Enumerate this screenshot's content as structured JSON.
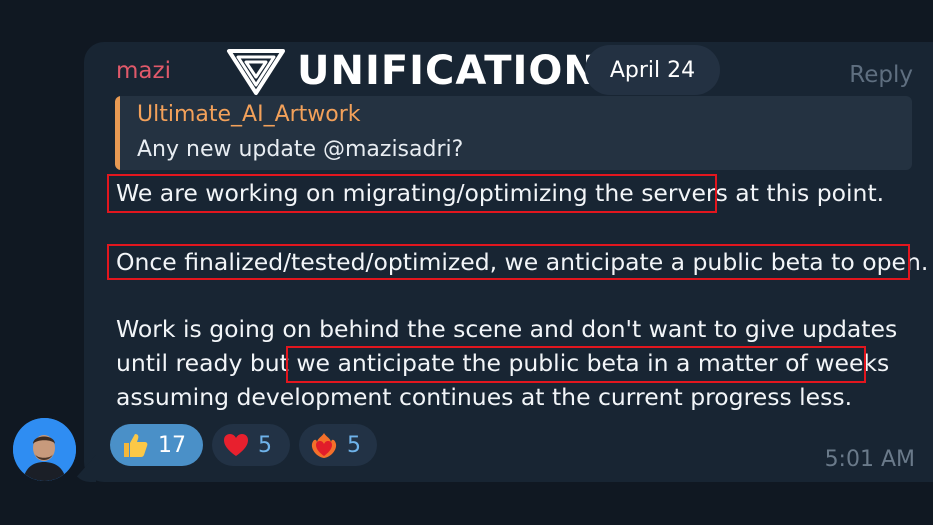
{
  "message": {
    "sender": "mazi",
    "reply_label": "Reply",
    "date": "April 24",
    "time": "5:01 AM",
    "quote": {
      "author": "Ultimate_AI_Artwork",
      "text": "Any new update @mazisadri?"
    },
    "lines": [
      "We are working on migrating/optimizing the servers at this point.",
      "Once finalized/tested/optimized, we anticipate a public beta to open.",
      "Work is going on behind the scene and don't want to give updates",
      "until ready but we anticipate the public beta in a matter of weeks",
      "assuming development continues at the current progress less."
    ]
  },
  "watermark": {
    "text": "UNIFICATION"
  },
  "reactions": [
    {
      "emoji": "thumbs-up",
      "count": "17"
    },
    {
      "emoji": "red-heart",
      "count": "5"
    },
    {
      "emoji": "heart-on-fire",
      "count": "5"
    }
  ],
  "colors": {
    "background": "#101822",
    "bubble": "#182533",
    "sender": "#e0596a",
    "quote_accent": "#e89a53",
    "highlight_box": "#e2161e",
    "active_reaction": "#4a90c8"
  }
}
